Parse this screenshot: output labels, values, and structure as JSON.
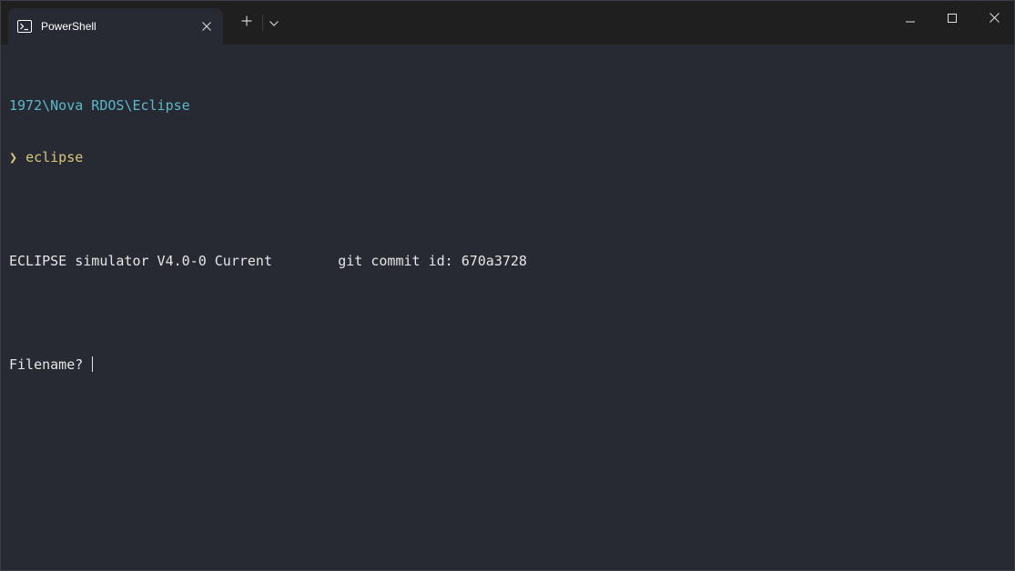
{
  "tab": {
    "title": "PowerShell",
    "icon": "powershell-icon"
  },
  "titlebar": {
    "new_tab_icon": "plus-icon",
    "dropdown_icon": "chevron-down-icon",
    "minimize_icon": "minimize-icon",
    "maximize_icon": "maximize-icon",
    "close_icon": "close-icon"
  },
  "terminal": {
    "prompt_path": "1972\\Nova RDOS\\Eclipse",
    "prompt_symbol": "❯",
    "command": "eclipse",
    "output_version": "ECLIPSE simulator V4.0-0 Current",
    "output_commit": "git commit id: 670a3728",
    "input_prompt": "Filename?",
    "input_value": ""
  },
  "colors": {
    "background": "#272a33",
    "titlebar": "#1f1f1f",
    "path": "#5ab9c9",
    "command": "#d8c77a",
    "text": "#e6e6e6"
  }
}
